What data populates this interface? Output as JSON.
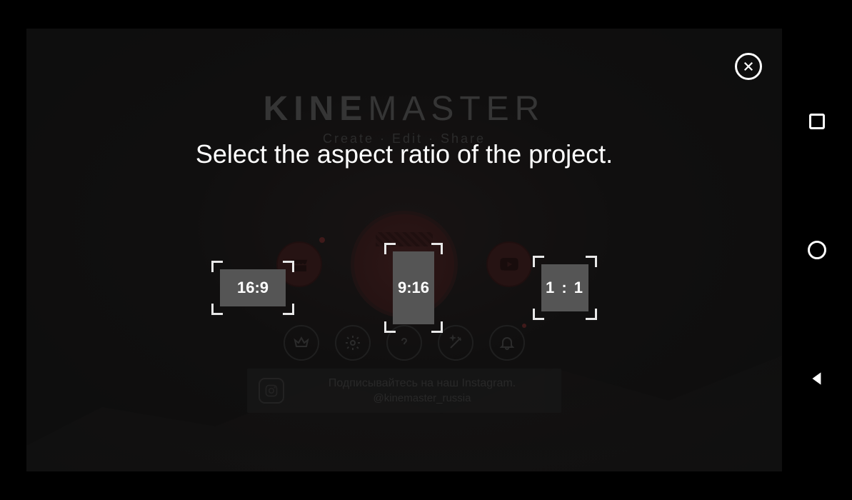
{
  "brand": {
    "kine": "KINE",
    "master": "MASTER",
    "subtitle": "Create · Edit · Share"
  },
  "dialog": {
    "title": "Select the aspect ratio of the project."
  },
  "ratios": {
    "r169": "16:9",
    "r916": "9:16",
    "r11": "1 : 1"
  },
  "promo": {
    "line1": "Подписывайтесь на наш Instagram.",
    "line2": "@kinemaster_russia"
  },
  "icons": {
    "close": "close",
    "store": "store",
    "plus": "+",
    "youtube": "youtube",
    "crown": "crown",
    "gear": "gear",
    "help": "?",
    "wand": "wand",
    "bell": "bell",
    "instagram": "instagram"
  }
}
